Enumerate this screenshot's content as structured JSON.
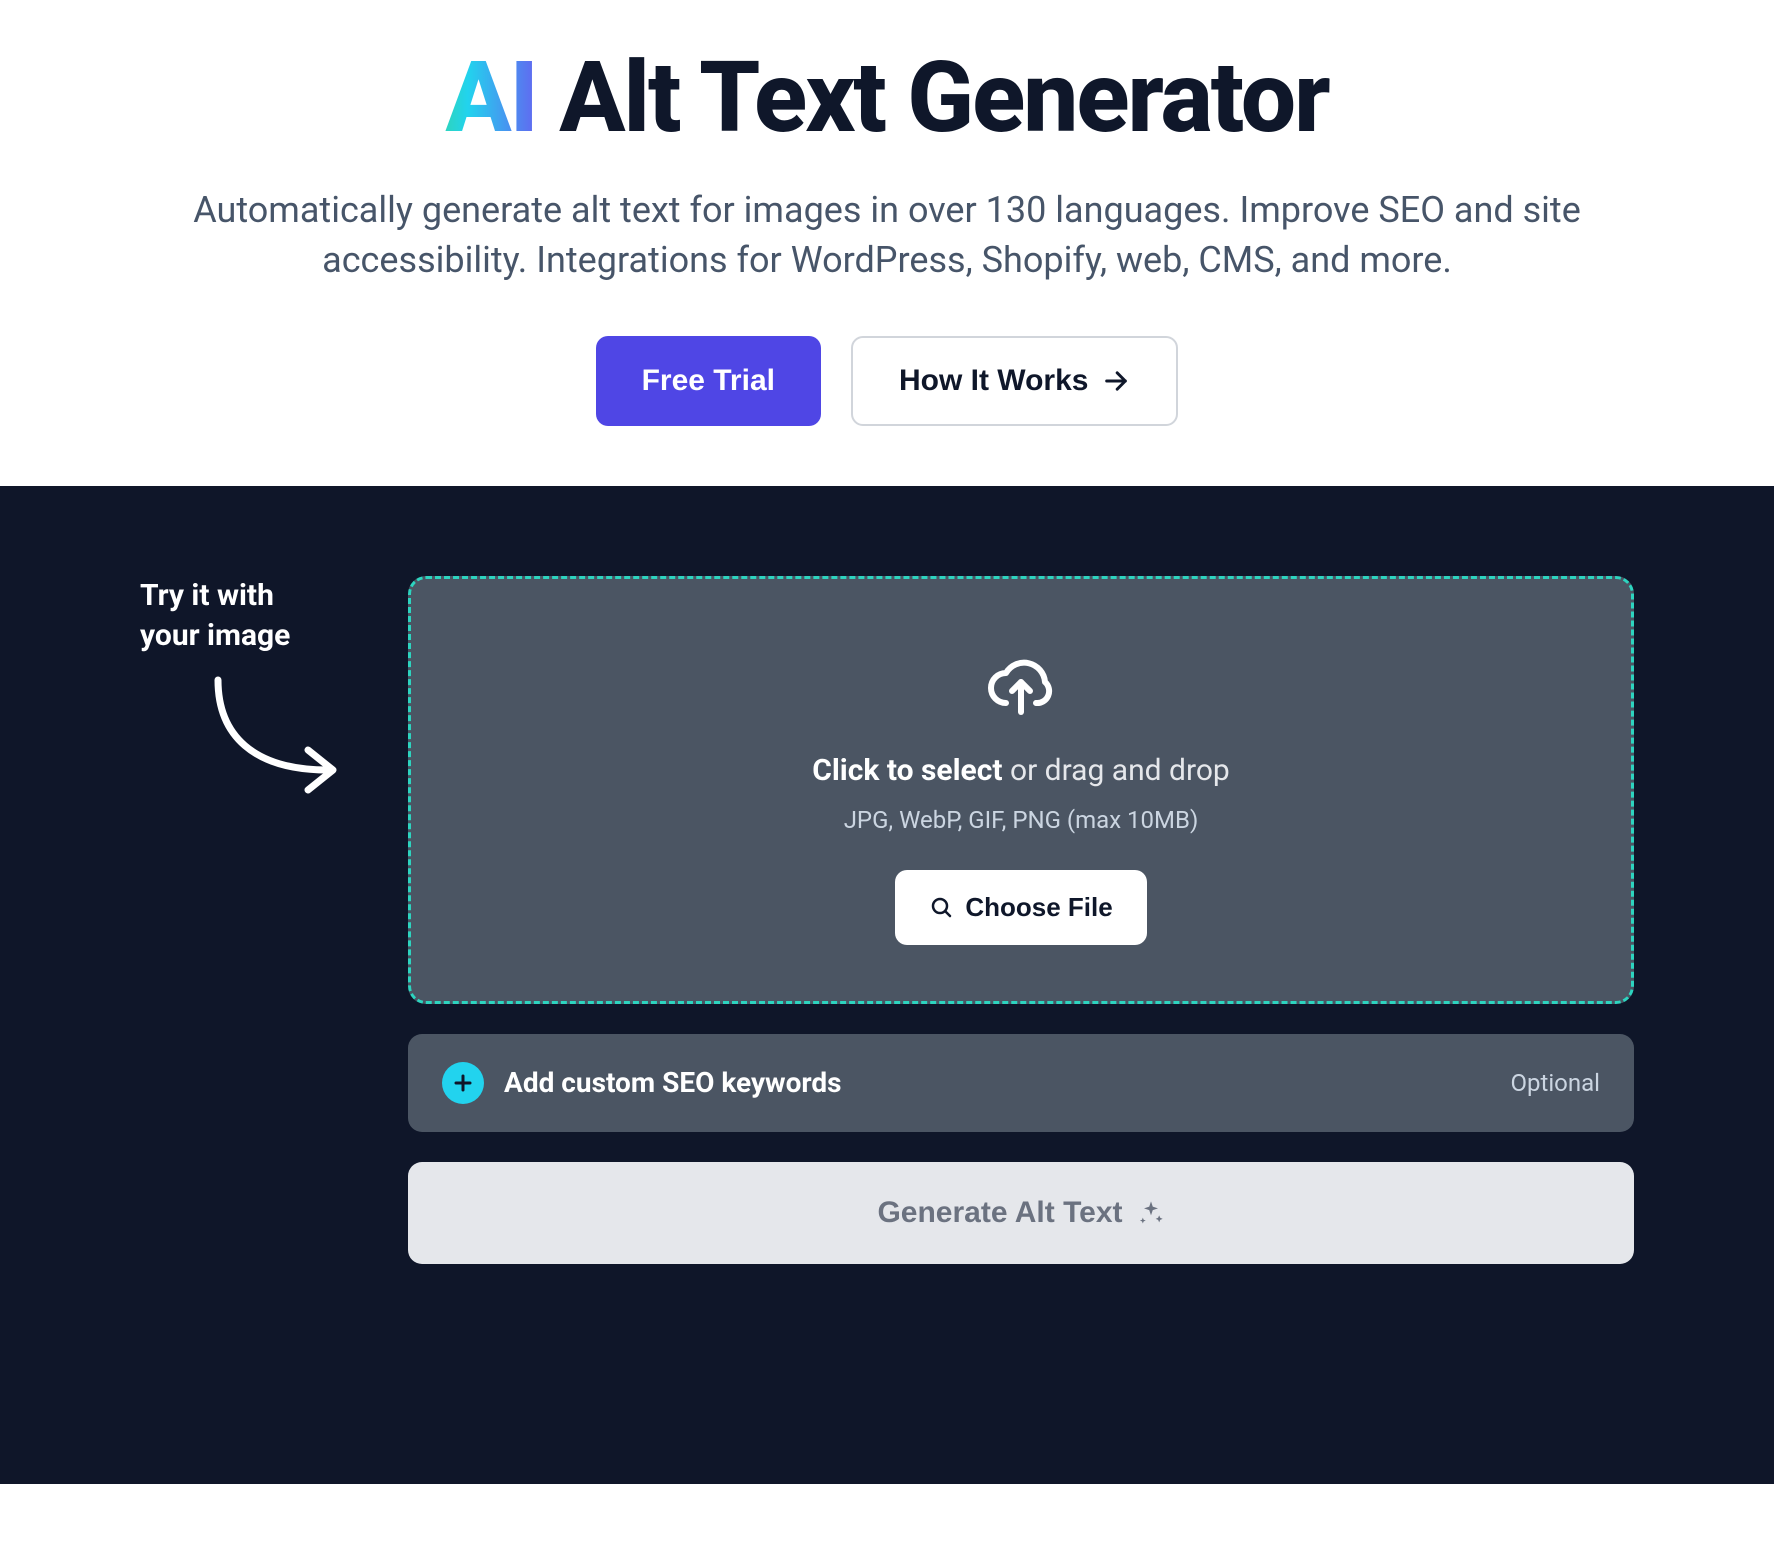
{
  "hero": {
    "title_prefix": "AI",
    "title_rest": " Alt Text Generator",
    "subtitle": "Automatically generate alt text for images in over 130 languages. Improve SEO and site accessibility. Integrations for WordPress, Shopify, web, CMS, and more.",
    "free_trial_label": "Free Trial",
    "how_it_works_label": "How It Works"
  },
  "upload": {
    "hint_line1": "Try it with",
    "hint_line2": "your image",
    "click_strong": "Click to select",
    "click_rest": " or drag and drop",
    "formats": "JPG, WebP, GIF, PNG (max 10MB)",
    "choose_file_label": "Choose File"
  },
  "seo": {
    "label": "Add custom SEO keywords",
    "optional": "Optional"
  },
  "generate": {
    "label": "Generate Alt Text"
  }
}
